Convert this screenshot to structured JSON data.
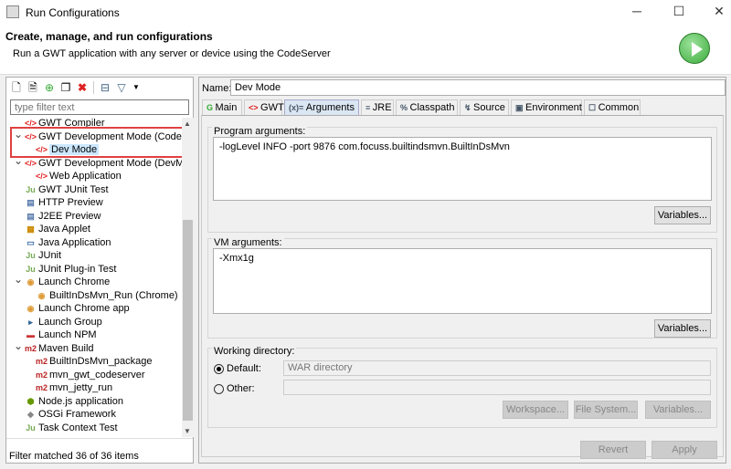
{
  "window": {
    "title": "Run Configurations",
    "minimize": "─",
    "maximize": "☐",
    "close": "✕"
  },
  "banner": {
    "title": "Create, manage, and run configurations",
    "subtitle": "Run a GWT application with any server or device using the CodeServer"
  },
  "left": {
    "toolbar": [
      "new",
      "duplicate-prototype",
      "new-prototype",
      "duplicate",
      "delete",
      "collapse-all",
      "filter",
      "menu"
    ],
    "filter_placeholder": "type filter text",
    "tree": [
      {
        "label": "GWT Compiler",
        "level": 1,
        "icon": "gwt"
      },
      {
        "label": "GWT Development Mode (CodeServ",
        "level": 0,
        "icon": "gwt",
        "expanded": true,
        "highlighted": true
      },
      {
        "label": "Dev Mode",
        "level": 2,
        "icon": "gwt",
        "selected": true
      },
      {
        "label": "GWT Development Mode (DevMode",
        "level": 0,
        "icon": "gwt",
        "expanded": true
      },
      {
        "label": "Web Application",
        "level": 2,
        "icon": "gwt"
      },
      {
        "label": "GWT JUnit Test",
        "level": 1,
        "icon": "ju"
      },
      {
        "label": "HTTP Preview",
        "level": 1,
        "icon": "page"
      },
      {
        "label": "J2EE Preview",
        "level": 1,
        "icon": "page"
      },
      {
        "label": "Java Applet",
        "level": 1,
        "icon": "applet"
      },
      {
        "label": "Java Application",
        "level": 1,
        "icon": "app"
      },
      {
        "label": "JUnit",
        "level": 1,
        "icon": "ju"
      },
      {
        "label": "JUnit Plug-in Test",
        "level": 1,
        "icon": "ju"
      },
      {
        "label": "Launch Chrome",
        "level": 0,
        "icon": "chrome",
        "expanded": true
      },
      {
        "label": "BuiltInDsMvn_Run (Chrome)",
        "level": 2,
        "icon": "chrome"
      },
      {
        "label": "Launch Chrome app",
        "level": 1,
        "icon": "chrome"
      },
      {
        "label": "Launch Group",
        "level": 1,
        "icon": "group"
      },
      {
        "label": "Launch NPM",
        "level": 1,
        "icon": "npm"
      },
      {
        "label": "Maven Build",
        "level": 0,
        "icon": "m2",
        "expanded": true
      },
      {
        "label": "BuiltInDsMvn_package",
        "level": 2,
        "icon": "m2"
      },
      {
        "label": "mvn_gwt_codeserver",
        "level": 2,
        "icon": "m2"
      },
      {
        "label": "mvn_jetty_run",
        "level": 2,
        "icon": "m2"
      },
      {
        "label": "Node.js application",
        "level": 1,
        "icon": "node"
      },
      {
        "label": "OSGi Framework",
        "level": 1,
        "icon": "osgi"
      },
      {
        "label": "Task Context Test",
        "level": 1,
        "icon": "ju"
      }
    ],
    "status": "Filter matched 36 of 36 items"
  },
  "right": {
    "name_label": "Name:",
    "name_value": "Dev Mode",
    "tabs": [
      {
        "label": "Main",
        "icon": "G"
      },
      {
        "label": "GWT",
        "icon": "<>"
      },
      {
        "label": "Arguments",
        "icon": "(x)=",
        "selected": true
      },
      {
        "label": "JRE",
        "icon": "≡"
      },
      {
        "label": "Classpath",
        "icon": "%"
      },
      {
        "label": "Source",
        "icon": "↯"
      },
      {
        "label": "Environment",
        "icon": "▣"
      },
      {
        "label": "Common",
        "icon": "☐"
      }
    ],
    "program_label": "Program arguments:",
    "program_value": "-logLevel INFO -port 9876 com.focuss.builtindsmvn.BuiltInDsMvn",
    "vm_label": "VM arguments:",
    "vm_value": "-Xmx1g",
    "variables": "Variables...",
    "workdir_label": "Working directory:",
    "default_label": "Default:",
    "default_value": "WAR directory",
    "other_label": "Other:",
    "other_value": "",
    "workspace": "Workspace...",
    "filesystem": "File System...",
    "revert": "Revert",
    "apply": "Apply"
  },
  "colors": {
    "gwt": "#e02020",
    "selection": "#cce8ff",
    "highlight_box": "#e04040",
    "run": "#3cab3c"
  }
}
